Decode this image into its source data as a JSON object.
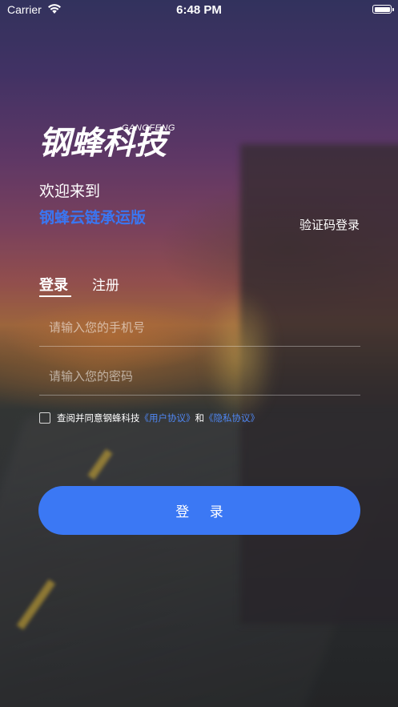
{
  "status_bar": {
    "carrier": "Carrier",
    "time": "6:48 PM",
    "battery_level": 1.0
  },
  "logo": {
    "chinese": "钢蜂科技",
    "english": "GANGFENG"
  },
  "header": {
    "welcome": "欢迎来到",
    "app_name": "钢蜂云链承运版",
    "sms_login": "验证码登录"
  },
  "tabs": [
    {
      "label": "登录",
      "active": true
    },
    {
      "label": "注册",
      "active": false
    }
  ],
  "form": {
    "phone_placeholder": "请输入您的手机号",
    "phone_value": "",
    "password_placeholder": "请输入您的密码",
    "password_value": ""
  },
  "agreement": {
    "checked": false,
    "prefix": "查阅并同意钢蜂科技",
    "user_agreement": "《用户协议》",
    "conjunction": "和",
    "privacy_policy": "《隐私协议》"
  },
  "login_button": "登 录",
  "colors": {
    "accent": "#3b78f4",
    "link": "#4f87f3",
    "app_name": "#3a76f2"
  },
  "icons": [
    "wifi-icon",
    "battery-icon",
    "checkbox-icon"
  ]
}
